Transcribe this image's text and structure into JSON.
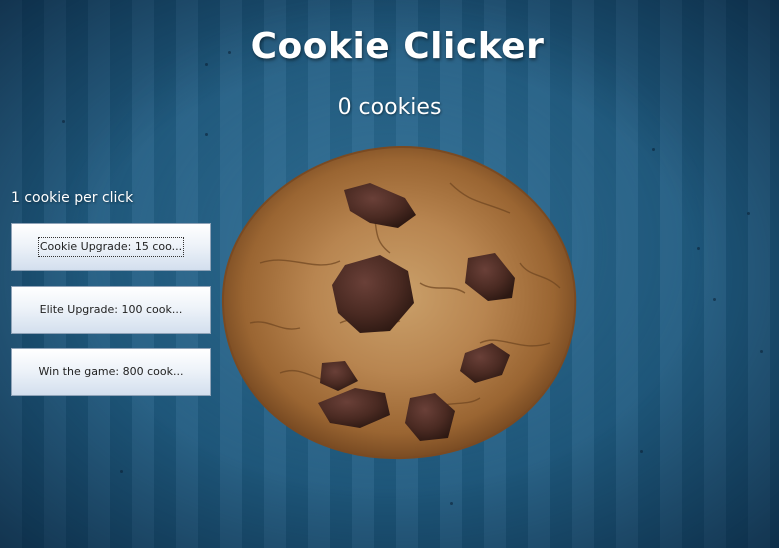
{
  "game": {
    "title": "Cookie Clicker",
    "cookie_count": "0 cookies",
    "per_click": "1 cookie per click"
  },
  "store": {
    "buttons": [
      {
        "label": "Cookie Upgrade: 15 coo..."
      },
      {
        "label": "Elite Upgrade: 100 cook..."
      },
      {
        "label": "Win the game: 800 cook..."
      }
    ]
  },
  "cookie": {
    "icon": "chocolate-chip-cookie-icon",
    "dough_color": "#a8723d",
    "chip_color": "#4a2a22"
  },
  "colors": {
    "background": "#1f5a7f",
    "text": "#ffffff"
  }
}
